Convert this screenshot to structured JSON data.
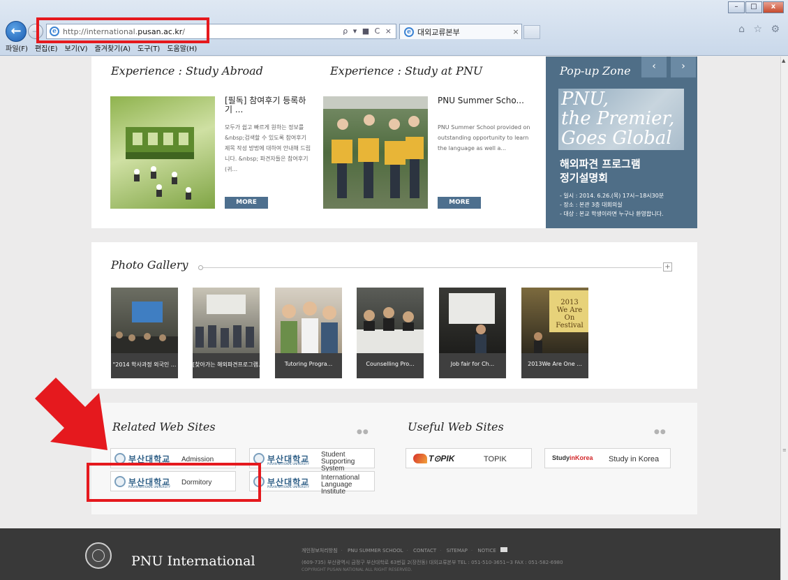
{
  "browser": {
    "url_host_prefix": "http://international.",
    "url_host_main": "pusan.ac.kr",
    "url_path": "/",
    "tab_title": "대외교류본부",
    "tab_close": "×",
    "addr_tools": "ρ ▾ ■ C ×",
    "window_controls": [
      "–",
      "□",
      "x"
    ],
    "menu": [
      "파일(F)",
      "편집(E)",
      "보기(V)",
      "즐겨찾기(A)",
      "도구(T)",
      "도움말(H)"
    ],
    "right_icons": "⌂ ☆ ⚙"
  },
  "experience": {
    "abroad": {
      "section_title": "Experience : Study Abroad",
      "headline": "[필독] 참여후기 등록하기 ...",
      "body": "모두가 쉽고 빠르게 원하는 정보를&nbsp;검색할 수 있도록 참여후기 제목 작성 방법에 대하여 안내해 드립니다. &nbsp; 파견자들은 참여후기(귀...",
      "more_label": "MORE"
    },
    "at_pnu": {
      "section_title": "Experience : Study at PNU",
      "headline": "PNU Summer Scho...",
      "body": "PNU Summer School provided on outstanding opportunity to learn the language as well a...",
      "more_label": "MORE"
    }
  },
  "popup": {
    "title": "Pop-up Zone",
    "prev": "‹",
    "next": "›",
    "banner_lines": [
      "PNU,",
      "the Premier,",
      "Goes Global"
    ],
    "headline_lines": [
      "해외파견 프로그램",
      "정기설명회"
    ],
    "info_lines": [
      "- 일시 : 2014. 6.26.(목) 17시~18시30분",
      "- 장소 : 본관 3층 대회의실",
      "- 대상 : 본교 학생이라면 누구나 환영합니다."
    ]
  },
  "gallery": {
    "title": "Photo Gallery",
    "more": "+",
    "items": [
      {
        "caption": "\"2014 학사과정 외국인 ..."
      },
      {
        "caption": "[찾아가는 해외파견프로그램..."
      },
      {
        "caption": "Tutoring Progra..."
      },
      {
        "caption": "Counselling Pro..."
      },
      {
        "caption": "Job fair for Ch..."
      },
      {
        "caption": "2013We Are One ..."
      }
    ],
    "festival_text": [
      "2013",
      "We Are On",
      "Festival"
    ]
  },
  "related_sites": {
    "title": "Related Web Sites",
    "dots": "●●",
    "logo_korean": "부산대학교",
    "logo_english": "PUSAN NATIONAL UNIVERSITY",
    "items": [
      {
        "label_lines": [
          "Admission"
        ]
      },
      {
        "label_lines": [
          "Student",
          "Supporting System"
        ]
      },
      {
        "label_lines": [
          "Dormitory"
        ]
      },
      {
        "label_lines": [
          "International",
          "Language Institute"
        ]
      }
    ]
  },
  "useful_sites": {
    "title": "Useful Web Sites",
    "dots": "●●",
    "topik_logo": "T⊙PIK",
    "topik_label": "TOPIK",
    "sik_logo_a": "Study",
    "sik_logo_b": "inKorea",
    "sik_label": "Study in Korea"
  },
  "footer": {
    "title": "PNU International",
    "links": [
      "개인정보처리방침",
      "PNU SUMMER SCHOOL",
      "CONTACT",
      "SITEMAP",
      "NOTICE"
    ],
    "address": "(609-735) 부산광역시 금정구 부산대학로 63번길 2(장전동) 대외교류본부 TEL : 051-510-3651~3 FAX : 051-582-6980",
    "copyright": "COPYRIGHT PUSAN NATIONAL ALL RIGHT RESERVED."
  },
  "colors": {
    "popup_bg": "#4f6e87",
    "more_btn": "#4d6f8e",
    "footer_bg": "#393939",
    "annotation_red": "#e5191e"
  }
}
